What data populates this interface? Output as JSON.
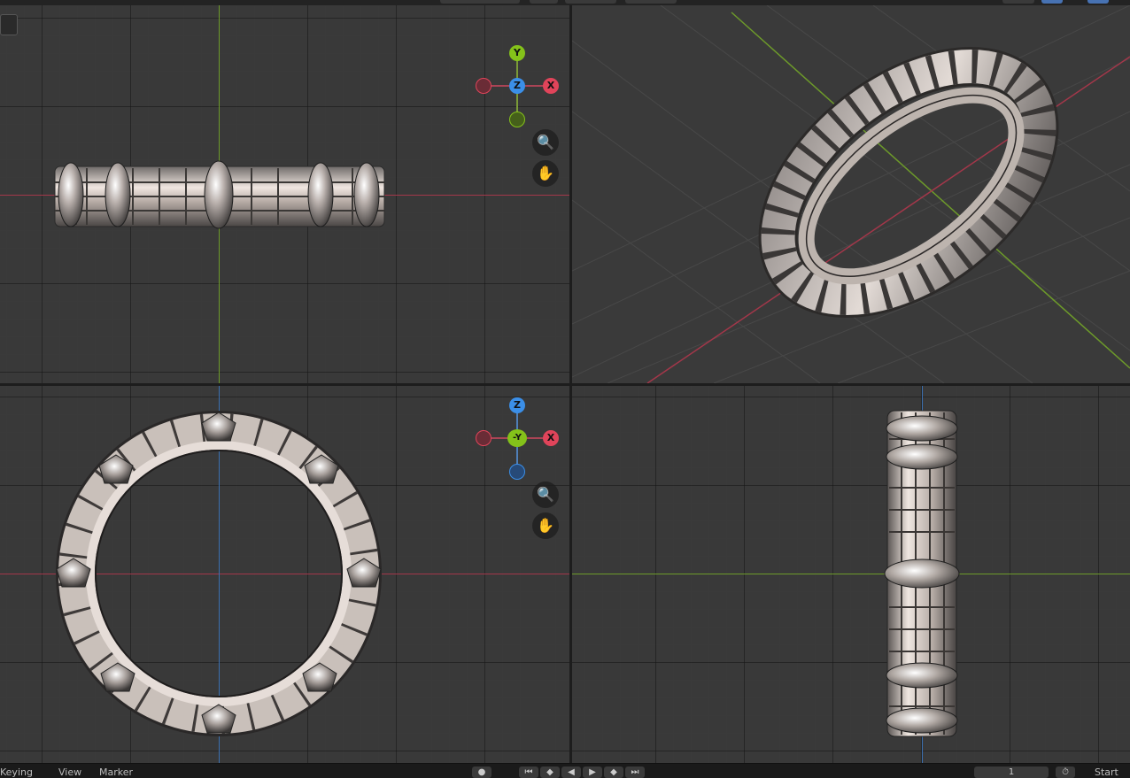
{
  "topbar": {
    "description": ""
  },
  "viewports": {
    "front": {
      "gizmo": {
        "top": "Y",
        "center": "Z",
        "right": "X"
      }
    },
    "top": {
      "gizmo": {
        "top": "Z",
        "center": "-Y",
        "right": "X"
      }
    }
  },
  "nav": {
    "zoom_icon": "zoom-icon",
    "pan_icon": "hand-icon"
  },
  "statusbar": {
    "menu_first": "Keying",
    "menu_view": "View",
    "menu_marker": "Marker",
    "frame_value": "1",
    "start_label": "Start"
  },
  "colors": {
    "x_axis": "#e0445a",
    "y_axis": "#84c21a",
    "z_axis": "#3b8fe8",
    "grid_bg": "#393939"
  }
}
